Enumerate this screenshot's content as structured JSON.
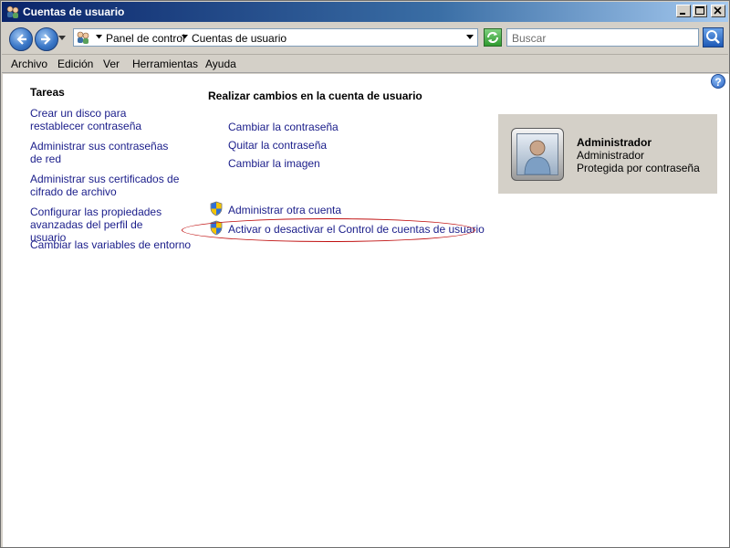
{
  "window": {
    "title": "Cuentas de usuario"
  },
  "navigation": {
    "breadcrumb": [
      "Panel de control",
      "Cuentas de usuario"
    ],
    "search_placeholder": "Buscar"
  },
  "menu": [
    "Archivo",
    "Edición",
    "Ver",
    "Herramientas",
    "Ayuda"
  ],
  "help_glyph": "?",
  "sidebar": {
    "title": "Tareas",
    "links": [
      "Crear un disco para restablecer contraseña",
      "Administrar sus contraseñas de red",
      "Administrar sus certificados de cifrado de archivo",
      "Configurar las propiedades avanzadas del perfil de usuario",
      "Cambiar las variables de entorno"
    ]
  },
  "main": {
    "title": "Realizar cambios en la cuenta de usuario",
    "actions": [
      "Cambiar la contraseña",
      "Quitar la contraseña",
      "Cambiar la imagen"
    ],
    "admin_actions": [
      "Administrar otra cuenta",
      "Activar o desactivar el Control de cuentas de usuario"
    ]
  },
  "account": {
    "name": "Administrador",
    "type": "Administrador",
    "status": "Protegida por contraseña"
  },
  "colors": {
    "link": "#1a1d8a",
    "highlight_ellipse": "#c01010",
    "titlebar": "#0a246a"
  },
  "icons": {
    "app": "users-icon",
    "back": "back-arrow-icon",
    "forward": "forward-arrow-icon",
    "refresh": "refresh-icon",
    "search": "magnifier-icon",
    "shield": "uac-shield-icon",
    "help": "help-icon"
  }
}
